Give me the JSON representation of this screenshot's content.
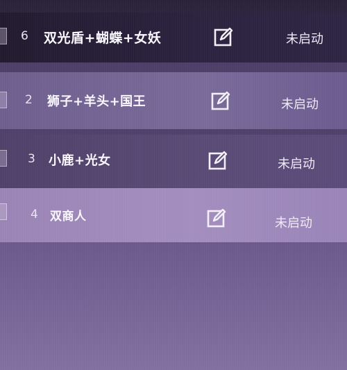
{
  "rows": [
    {
      "num": "6",
      "name": "双光盾+蝴蝶+女妖",
      "status": "未启动"
    },
    {
      "num": "2",
      "name": "狮子+羊头+国王",
      "status": "未启动"
    },
    {
      "num": "3",
      "name": "小鹿+光女",
      "status": "未启动"
    },
    {
      "num": "4",
      "name": "双商人",
      "status": "未启动"
    }
  ],
  "icons": {
    "edit": "edit-icon"
  }
}
